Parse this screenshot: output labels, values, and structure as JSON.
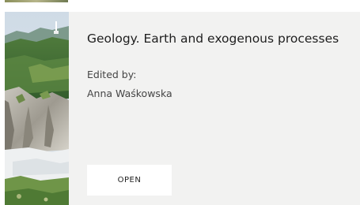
{
  "book": {
    "title": "Geology. Earth and exogenous processes",
    "edited_label": "Edited by:",
    "editor": "Anna Waśkowska",
    "open_label": "OPEN",
    "cover_image": "mountain-landscape-photo"
  },
  "colors": {
    "card_background": "#f2f2f1",
    "button_background": "#ffffff",
    "text_primary": "#1e1e1e",
    "text_secondary": "#444444"
  }
}
